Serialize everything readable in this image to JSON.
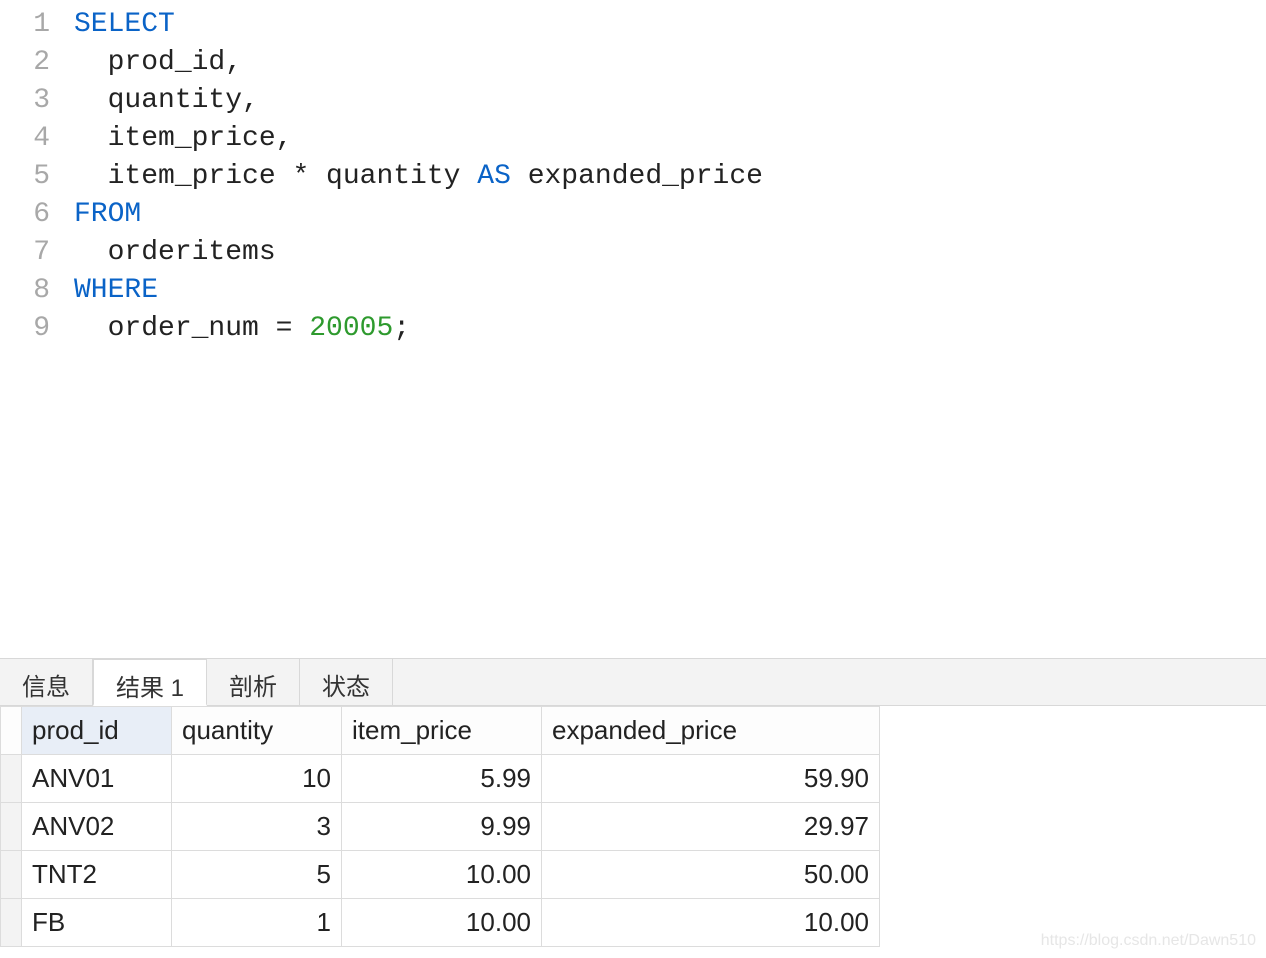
{
  "code": {
    "lines": [
      {
        "n": "1",
        "indent": "",
        "tokens": [
          {
            "t": "SELECT",
            "c": "kw"
          }
        ]
      },
      {
        "n": "2",
        "indent": "  ",
        "tokens": [
          {
            "t": "prod_id,",
            "c": ""
          }
        ]
      },
      {
        "n": "3",
        "indent": "  ",
        "tokens": [
          {
            "t": "quantity,",
            "c": ""
          }
        ]
      },
      {
        "n": "4",
        "indent": "  ",
        "tokens": [
          {
            "t": "item_price,",
            "c": ""
          }
        ]
      },
      {
        "n": "5",
        "indent": "  ",
        "tokens": [
          {
            "t": "item_price * quantity ",
            "c": ""
          },
          {
            "t": "AS",
            "c": "kw"
          },
          {
            "t": " expanded_price",
            "c": ""
          }
        ]
      },
      {
        "n": "6",
        "indent": "",
        "tokens": [
          {
            "t": "FROM",
            "c": "kw"
          }
        ]
      },
      {
        "n": "7",
        "indent": "  ",
        "tokens": [
          {
            "t": "orderitems",
            "c": ""
          }
        ]
      },
      {
        "n": "8",
        "indent": "",
        "tokens": [
          {
            "t": "WHERE",
            "c": "kw"
          }
        ]
      },
      {
        "n": "9",
        "indent": "  ",
        "tokens": [
          {
            "t": "order_num = ",
            "c": ""
          },
          {
            "t": "20005",
            "c": "num"
          },
          {
            "t": ";",
            "c": ""
          }
        ]
      }
    ]
  },
  "tabs": {
    "items": [
      {
        "label": "信息",
        "active": false
      },
      {
        "label": "结果 1",
        "active": true
      },
      {
        "label": "剖析",
        "active": false
      },
      {
        "label": "状态",
        "active": false
      }
    ]
  },
  "results": {
    "columns": [
      "prod_id",
      "quantity",
      "item_price",
      "expanded_price"
    ],
    "rows": [
      {
        "prod_id": "ANV01",
        "quantity": "10",
        "item_price": "5.99",
        "expanded_price": "59.90"
      },
      {
        "prod_id": "ANV02",
        "quantity": "3",
        "item_price": "9.99",
        "expanded_price": "29.97"
      },
      {
        "prod_id": "TNT2",
        "quantity": "5",
        "item_price": "10.00",
        "expanded_price": "50.00"
      },
      {
        "prod_id": "FB",
        "quantity": "1",
        "item_price": "10.00",
        "expanded_price": "10.00"
      }
    ]
  },
  "watermark": "https://blog.csdn.net/Dawn510"
}
